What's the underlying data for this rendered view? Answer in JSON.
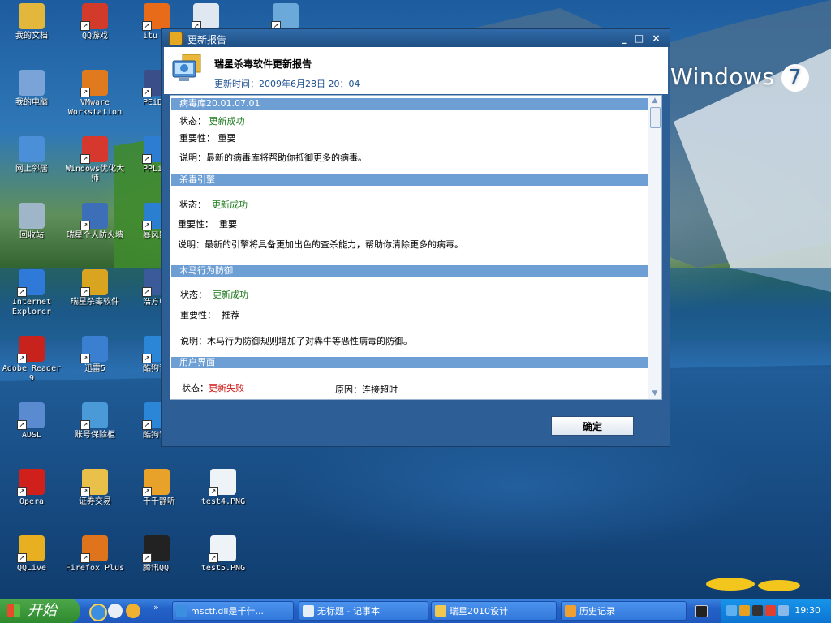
{
  "desktop": {
    "brand_text": "Windows",
    "brand_number": "7",
    "icons": [
      {
        "label": "我的文档",
        "icon": "my-documents-icon",
        "color": "#e3b63c"
      },
      {
        "label": "QQ游戏",
        "icon": "qq-game-icon",
        "color": "#d23a2a"
      },
      {
        "label": "itu",
        "icon": "itunes-icon",
        "color": "#e86b1a"
      },
      {
        "label": "",
        "icon": "window-thumbnail-icon",
        "color": "#dfe7f0"
      },
      {
        "label": "",
        "icon": "image-file-icon",
        "color": "#6aa9d9"
      },
      {
        "label": "我的电脑",
        "icon": "my-computer-icon",
        "color": "#7aa4d8"
      },
      {
        "label": "VMware Workstation",
        "icon": "vmware-icon",
        "color": "#e07a1f"
      },
      {
        "label": "PEiD v",
        "icon": "peid-icon",
        "color": "#3a4f8a"
      },
      {
        "label": "网上邻居",
        "icon": "network-places-icon",
        "color": "#4a8fd8"
      },
      {
        "label": "Windows优化大师",
        "icon": "windows-optimizer-icon",
        "color": "#d6382e"
      },
      {
        "label": "PPLive 电视",
        "icon": "pplive-icon",
        "color": "#2d7dd2"
      },
      {
        "label": "回收站",
        "icon": "recycle-bin-icon",
        "color": "#9fb6c9"
      },
      {
        "label": "瑞星个人防火墙",
        "icon": "rising-firewall-icon",
        "color": "#3c6fb8"
      },
      {
        "label": "暴风影",
        "icon": "baofeng-icon",
        "color": "#2a7fd0"
      },
      {
        "label": "Internet Explorer",
        "icon": "internet-explorer-icon",
        "color": "#2f7ad8"
      },
      {
        "label": "瑞星杀毒软件",
        "icon": "rising-antivirus-icon",
        "color": "#d9a520"
      },
      {
        "label": "浩方电竞",
        "icon": "haofang-icon",
        "color": "#3a5a9a"
      },
      {
        "label": "Adobe Reader 9",
        "icon": "adobe-reader-icon",
        "color": "#c8221d"
      },
      {
        "label": "迅雷5",
        "icon": "thunder-icon",
        "color": "#3b7fd0"
      },
      {
        "label": "酷狗音乐",
        "icon": "kugou-icon",
        "color": "#2b86d8"
      },
      {
        "label": "ADSL",
        "icon": "adsl-icon",
        "color": "#5a8ad0"
      },
      {
        "label": "账号保险柜",
        "icon": "account-safe-icon",
        "color": "#4a9ad8"
      },
      {
        "label": "酷狗音乐盒",
        "icon": "kugou-box-icon",
        "color": "#2b86d8"
      },
      {
        "label": "Opera",
        "icon": "opera-icon",
        "color": "#d0201c"
      },
      {
        "label": "证券交易",
        "icon": "folder-icon",
        "color": "#e8c04a"
      },
      {
        "label": "千千静听",
        "icon": "ttplayer-icon",
        "color": "#e8a22a"
      },
      {
        "label": "test4.PNG",
        "icon": "png-file-icon",
        "color": "#eef3f8"
      },
      {
        "label": "QQLive",
        "icon": "qqlive-icon",
        "color": "#e8b020"
      },
      {
        "label": "Firefox Plus",
        "icon": "firefox-icon",
        "color": "#e0741c"
      },
      {
        "label": "腾讯QQ",
        "icon": "qq-icon",
        "color": "#222222"
      },
      {
        "label": "test5.PNG",
        "icon": "png-file-icon",
        "color": "#eef3f8"
      }
    ]
  },
  "dialog": {
    "title": "更新报告",
    "controls": {
      "minimize": "_",
      "maximize": "□",
      "close": "×"
    },
    "header_title": "瑞星杀毒软件更新报告",
    "time_label": "更新时间：",
    "time_value": "2009年6月28日 20：04",
    "sections": [
      {
        "heading": "病毒库20.01.07.01",
        "status_label": "状态：",
        "status_value": "更新成功",
        "importance_label": "重要性：",
        "importance_value": "重要",
        "desc_label": "说明：",
        "desc_value": "最新的病毒库将帮助你抵御更多的病毒。"
      },
      {
        "heading": "杀毒引擎",
        "status_label": "状态：",
        "status_value": "更新成功",
        "importance_label": "重要性：",
        "importance_value": "重要",
        "desc_label": "说明：",
        "desc_value": "最新的引擎将具备更加出色的查杀能力，帮助你清除更多的病毒。"
      },
      {
        "heading": "木马行为防御",
        "status_label": "状态：",
        "status_value": "更新成功",
        "importance_label": "重要性：",
        "importance_value": "推荐",
        "desc_label": "说明：",
        "desc_value": "木马行为防御规则增加了对犇牛等恶性病毒的防御。"
      },
      {
        "heading": "用户界面",
        "status_label": "状态：",
        "status_value": "更新失败",
        "reason_label": "原因：",
        "reason_value": "连接超时"
      }
    ],
    "ok_button": "确定"
  },
  "taskbar": {
    "start_label": "开始",
    "overflow": "»",
    "tasks": [
      {
        "label": "msctf.dll是千什...",
        "icon": "ie-task-icon"
      },
      {
        "label": "无标题 - 记事本",
        "icon": "notepad-icon"
      },
      {
        "label": "瑞星2010设计",
        "icon": "folder-icon"
      },
      {
        "label": "历史记录",
        "icon": "history-icon"
      }
    ],
    "clock": "19:30"
  }
}
